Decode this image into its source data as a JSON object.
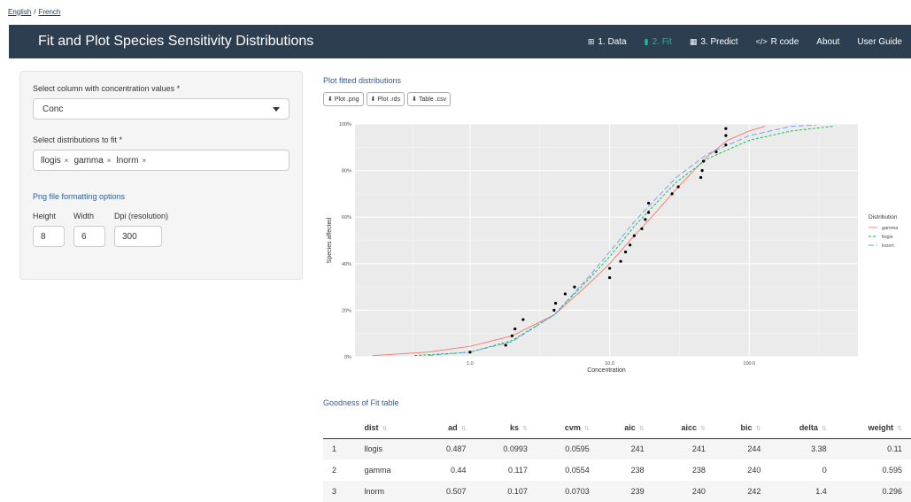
{
  "lang": {
    "english": "English",
    "french": "French",
    "sep": "/"
  },
  "navbar": {
    "title": "Fit and Plot Species Sensitivity Distributions",
    "items": [
      {
        "icon": "table-icon",
        "glyph": "⊞",
        "label": "1. Data"
      },
      {
        "icon": "bar-chart-icon",
        "glyph": "▮",
        "label": "2. Fit"
      },
      {
        "icon": "calculator-icon",
        "glyph": "▦",
        "label": "3. Predict"
      },
      {
        "icon": "code-icon",
        "glyph": "</>",
        "label": "R code"
      },
      {
        "icon": "",
        "glyph": "",
        "label": "About"
      },
      {
        "icon": "",
        "glyph": "",
        "label": "User Guide"
      }
    ],
    "active_index": 1,
    "accent": "#18bc9c"
  },
  "sidebar": {
    "conc_label": "Select column with concentration values *",
    "conc_value": "Conc",
    "dist_label": "Select distributions to fit *",
    "dists": [
      "llogis",
      "gamma",
      "lnorm"
    ],
    "remove_glyph": "×",
    "png_title": "Png file formatting options",
    "height_label": "Height",
    "height_value": "8",
    "width_label": "Width",
    "width_value": "6",
    "dpi_label": "Dpi (resolution)",
    "dpi_value": "300"
  },
  "main": {
    "plot_title": "Plot fitted distributions",
    "btn_png": "Plot .png",
    "btn_rds": "Plot .rds",
    "btn_csv": "Table .csv",
    "gof_title": "Goodness of Fit table"
  },
  "chart_data": {
    "type": "line",
    "xlabel": "Concentration",
    "ylabel": "Species affected",
    "x_scale": "log10",
    "xlim": [
      0.15,
      600
    ],
    "ylim": [
      0,
      1
    ],
    "x_ticks": [
      {
        "v": 1,
        "label": "1.0"
      },
      {
        "v": 10,
        "label": "10.0"
      },
      {
        "v": 100,
        "label": "100.0"
      }
    ],
    "y_ticks": [
      {
        "v": 0,
        "label": "0%"
      },
      {
        "v": 0.2,
        "label": "20%"
      },
      {
        "v": 0.4,
        "label": "40%"
      },
      {
        "v": 0.6,
        "label": "60%"
      },
      {
        "v": 0.8,
        "label": "80%"
      },
      {
        "v": 1,
        "label": "100%"
      }
    ],
    "legend_title": "Distribution",
    "legend_position": "right",
    "series": [
      {
        "name": "gamma",
        "color": "#f8766d",
        "dash": "",
        "points": [
          [
            0.2,
            0.005
          ],
          [
            0.5,
            0.02
          ],
          [
            1,
            0.045
          ],
          [
            2,
            0.09
          ],
          [
            4,
            0.18
          ],
          [
            7,
            0.31
          ],
          [
            10,
            0.4
          ],
          [
            15,
            0.52
          ],
          [
            20,
            0.6
          ],
          [
            30,
            0.72
          ],
          [
            50,
            0.86
          ],
          [
            70,
            0.93
          ],
          [
            100,
            0.97
          ],
          [
            130,
            0.99
          ]
        ]
      },
      {
        "name": "llogis",
        "color": "#00ba38",
        "dash": "3,2",
        "points": [
          [
            0.4,
            0.005
          ],
          [
            1,
            0.02
          ],
          [
            2,
            0.07
          ],
          [
            4,
            0.18
          ],
          [
            7,
            0.33
          ],
          [
            10,
            0.43
          ],
          [
            15,
            0.56
          ],
          [
            20,
            0.64
          ],
          [
            30,
            0.75
          ],
          [
            50,
            0.85
          ],
          [
            100,
            0.93
          ],
          [
            200,
            0.97
          ],
          [
            400,
            0.99
          ]
        ]
      },
      {
        "name": "lnorm",
        "color": "#619cff",
        "dash": "6,3",
        "points": [
          [
            0.5,
            0.005
          ],
          [
            1,
            0.02
          ],
          [
            2,
            0.065
          ],
          [
            4,
            0.18
          ],
          [
            7,
            0.34
          ],
          [
            10,
            0.45
          ],
          [
            15,
            0.58
          ],
          [
            20,
            0.66
          ],
          [
            30,
            0.77
          ],
          [
            50,
            0.87
          ],
          [
            100,
            0.95
          ],
          [
            200,
            0.99
          ],
          [
            300,
            0.995
          ]
        ]
      }
    ],
    "observations": [
      [
        1.0,
        0.02
      ],
      [
        1.8,
        0.05
      ],
      [
        2.0,
        0.09
      ],
      [
        2.1,
        0.12
      ],
      [
        2.4,
        0.16
      ],
      [
        4.0,
        0.2
      ],
      [
        4.1,
        0.23
      ],
      [
        4.8,
        0.27
      ],
      [
        5.6,
        0.3
      ],
      [
        10,
        0.34
      ],
      [
        10,
        0.38
      ],
      [
        12,
        0.41
      ],
      [
        13,
        0.45
      ],
      [
        14,
        0.48
      ],
      [
        15,
        0.52
      ],
      [
        17,
        0.55
      ],
      [
        18,
        0.59
      ],
      [
        19,
        0.62
      ],
      [
        19,
        0.66
      ],
      [
        28,
        0.7
      ],
      [
        31,
        0.73
      ],
      [
        45,
        0.77
      ],
      [
        46,
        0.8
      ],
      [
        47,
        0.84
      ],
      [
        58,
        0.88
      ],
      [
        68,
        0.91
      ],
      [
        68,
        0.95
      ],
      [
        68,
        0.98
      ]
    ]
  },
  "gof": {
    "headers": [
      "",
      "dist",
      "ad",
      "ks",
      "cvm",
      "aic",
      "aicc",
      "bic",
      "delta",
      "weight"
    ],
    "rows": [
      [
        "1",
        "llogis",
        "0.487",
        "0.0993",
        "0.0595",
        "241",
        "241",
        "244",
        "3.38",
        "0.11"
      ],
      [
        "2",
        "gamma",
        "0.44",
        "0.117",
        "0.0554",
        "238",
        "238",
        "240",
        "0",
        "0.595"
      ],
      [
        "3",
        "lnorm",
        "0.507",
        "0.107",
        "0.0703",
        "239",
        "240",
        "242",
        "1.4",
        "0.296"
      ]
    ]
  }
}
